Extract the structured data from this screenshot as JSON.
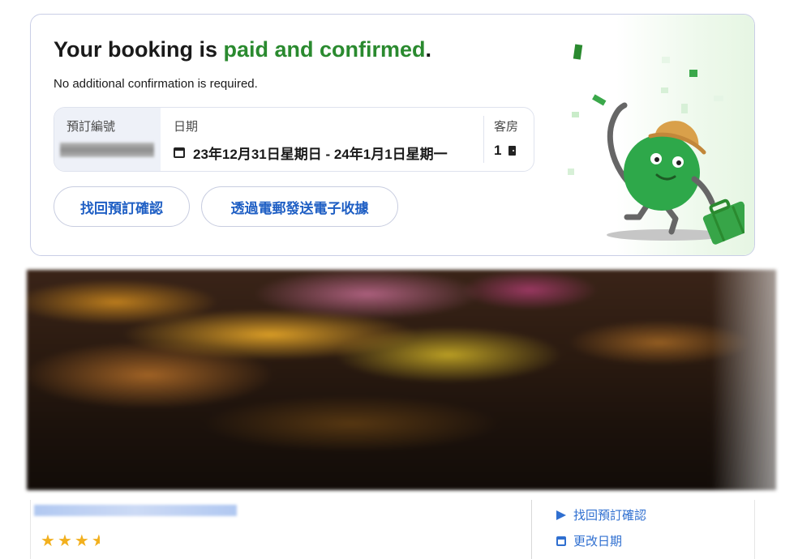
{
  "confirmation": {
    "headline_prefix": "Your booking is ",
    "headline_accent": "paid and confirmed",
    "headline_suffix": ".",
    "subline": "No additional confirmation is required.",
    "details": {
      "reference_label": "預訂編號",
      "date_label": "日期",
      "date_value": "23年12月31日星期日 - 24年1月1日星期一",
      "rooms_label": "客房",
      "rooms_value": "1"
    },
    "buttons": {
      "retrieve": "找回預訂確認",
      "email_receipt": "透過電郵發送電子收據"
    }
  },
  "property": {
    "star_rating": 3.5
  },
  "sidebar_links": {
    "retrieve": "找回預訂確認",
    "change_dates": "更改日期"
  },
  "colors": {
    "accent_green": "#2a8a2f",
    "link_blue": "#1f5fc4",
    "star": "#f2b01e",
    "mascot_green": "#2ea84a"
  },
  "icons": [
    "calendar-icon",
    "door-icon",
    "send-icon",
    "star-icon"
  ]
}
